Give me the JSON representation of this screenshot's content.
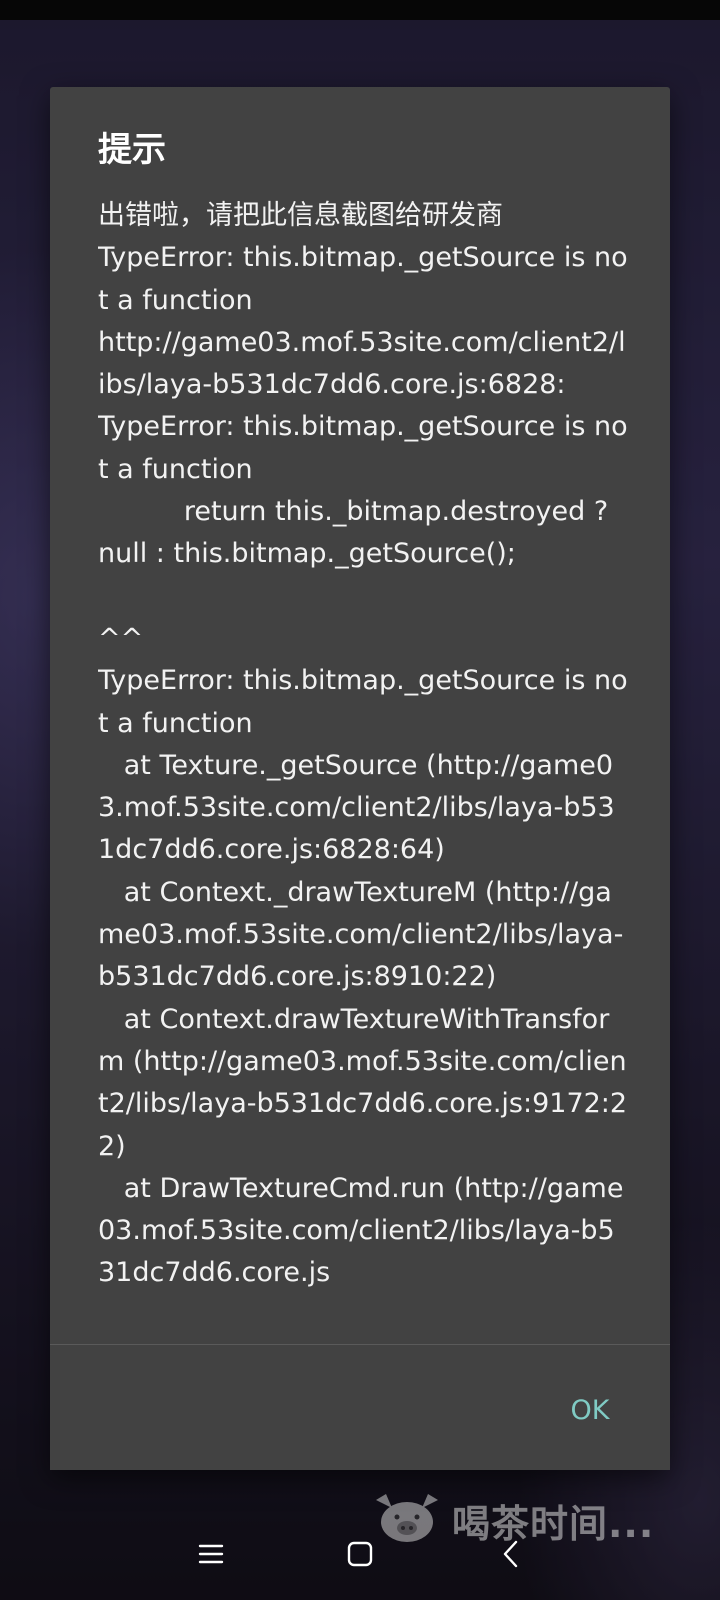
{
  "dialog": {
    "title": "提示",
    "message": "出错啦，请把此信息截图给研发商\nTypeError: this.bitmap._getSource is not a function\nhttp://game03.mof.53site.com/client2/libs/laya-b531dc7dd6.core.js:6828:\nTypeError: this.bitmap._getSource is not a function\n          return this._bitmap.destroyed ? null : this.bitmap._getSource();\n\n^^\nTypeError: this.bitmap._getSource is not a function\n   at Texture._getSource (http://game03.mof.53site.com/client2/libs/laya-b531dc7dd6.core.js:6828:64)\n   at Context._drawTextureM (http://game03.mof.53site.com/client2/libs/laya-b531dc7dd6.core.js:8910:22)\n   at Context.drawTextureWithTransform (http://game03.mof.53site.com/client2/libs/laya-b531dc7dd6.core.js:9172:22)\n   at DrawTextureCmd.run (http://game03.mof.53site.com/client2/libs/laya-b531dc7dd6.core.js",
    "ok_label": "OK"
  },
  "watermark": {
    "text": "喝茶时间...",
    "icon": "pig-logo-icon"
  },
  "navbar": {
    "icons": [
      "menu-icon",
      "home-icon",
      "back-icon"
    ]
  },
  "colors": {
    "dialog_bg": "#424242",
    "accent": "#80cbc4",
    "text": "#f2f2f2"
  }
}
